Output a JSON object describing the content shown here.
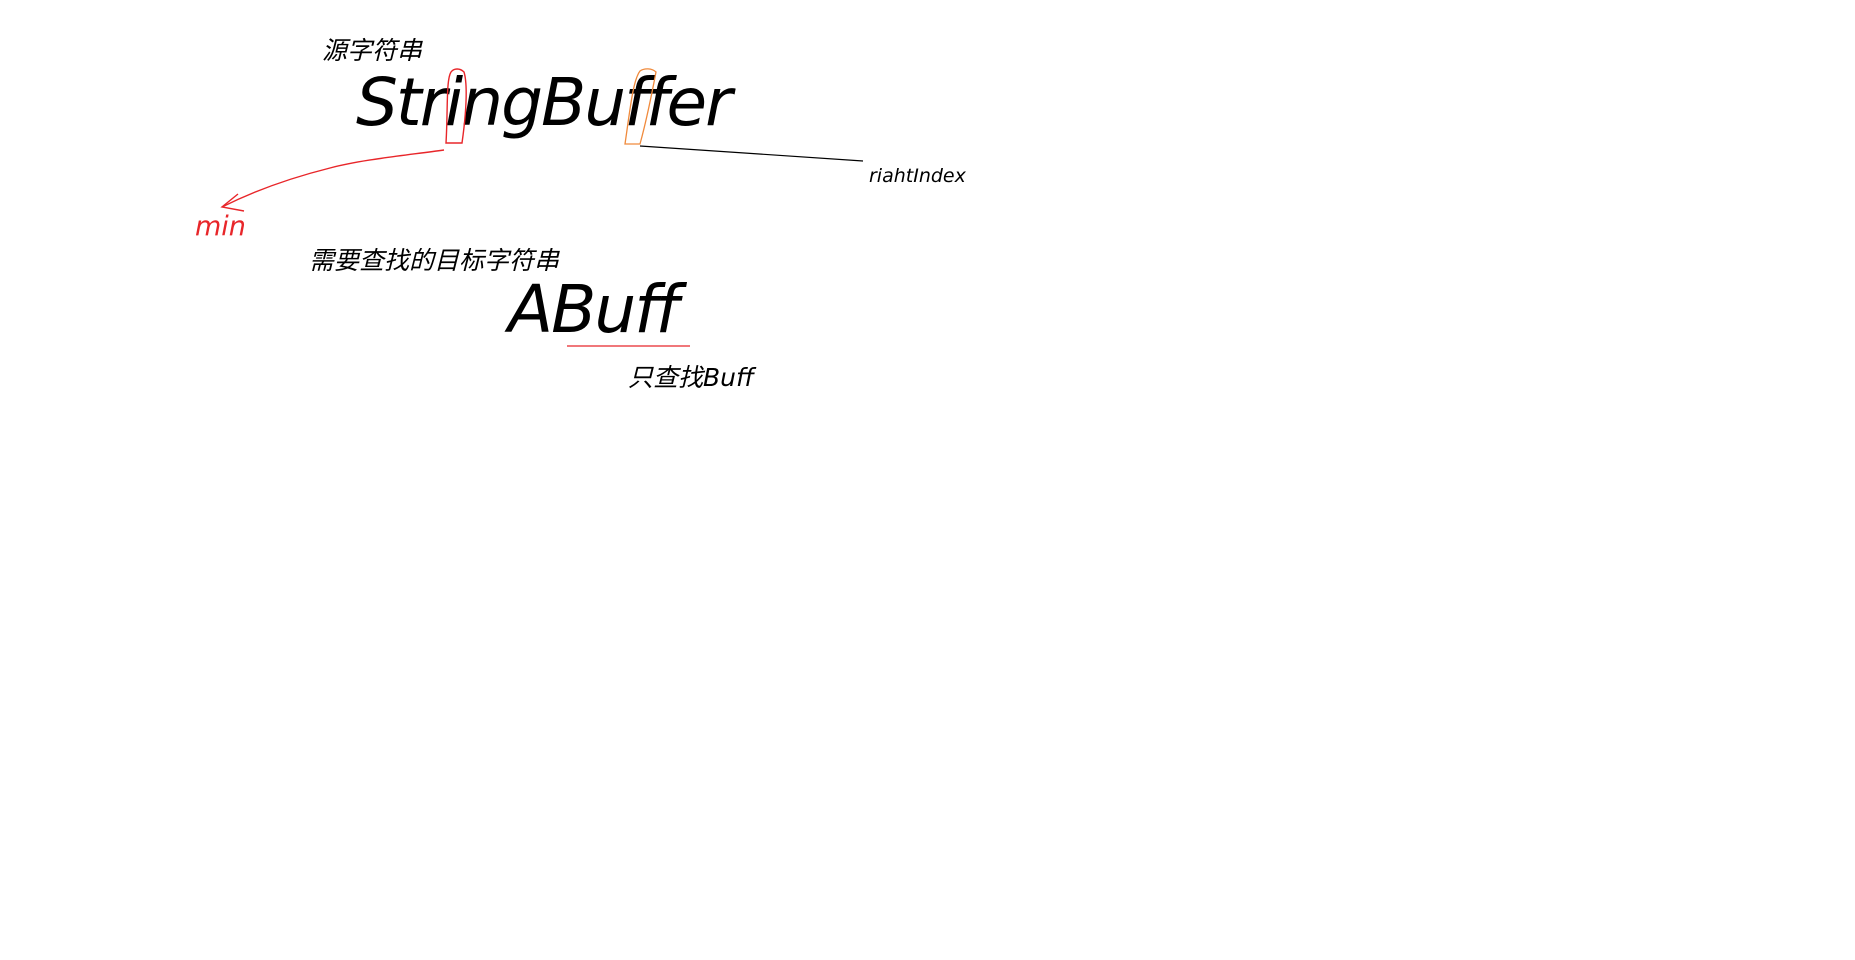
{
  "source_label": "源字符串",
  "source_string": "StringBuffer",
  "right_index_label": "riahtIndex",
  "min_label": "min",
  "target_label": "需要查找的目标字符串",
  "target_string": "ABuff",
  "only_find_note": "只查找Buff",
  "colors": {
    "text": "#000000",
    "min_marker": "#e8262a",
    "right_marker": "#f08a3c",
    "underline": "#e8262a"
  }
}
